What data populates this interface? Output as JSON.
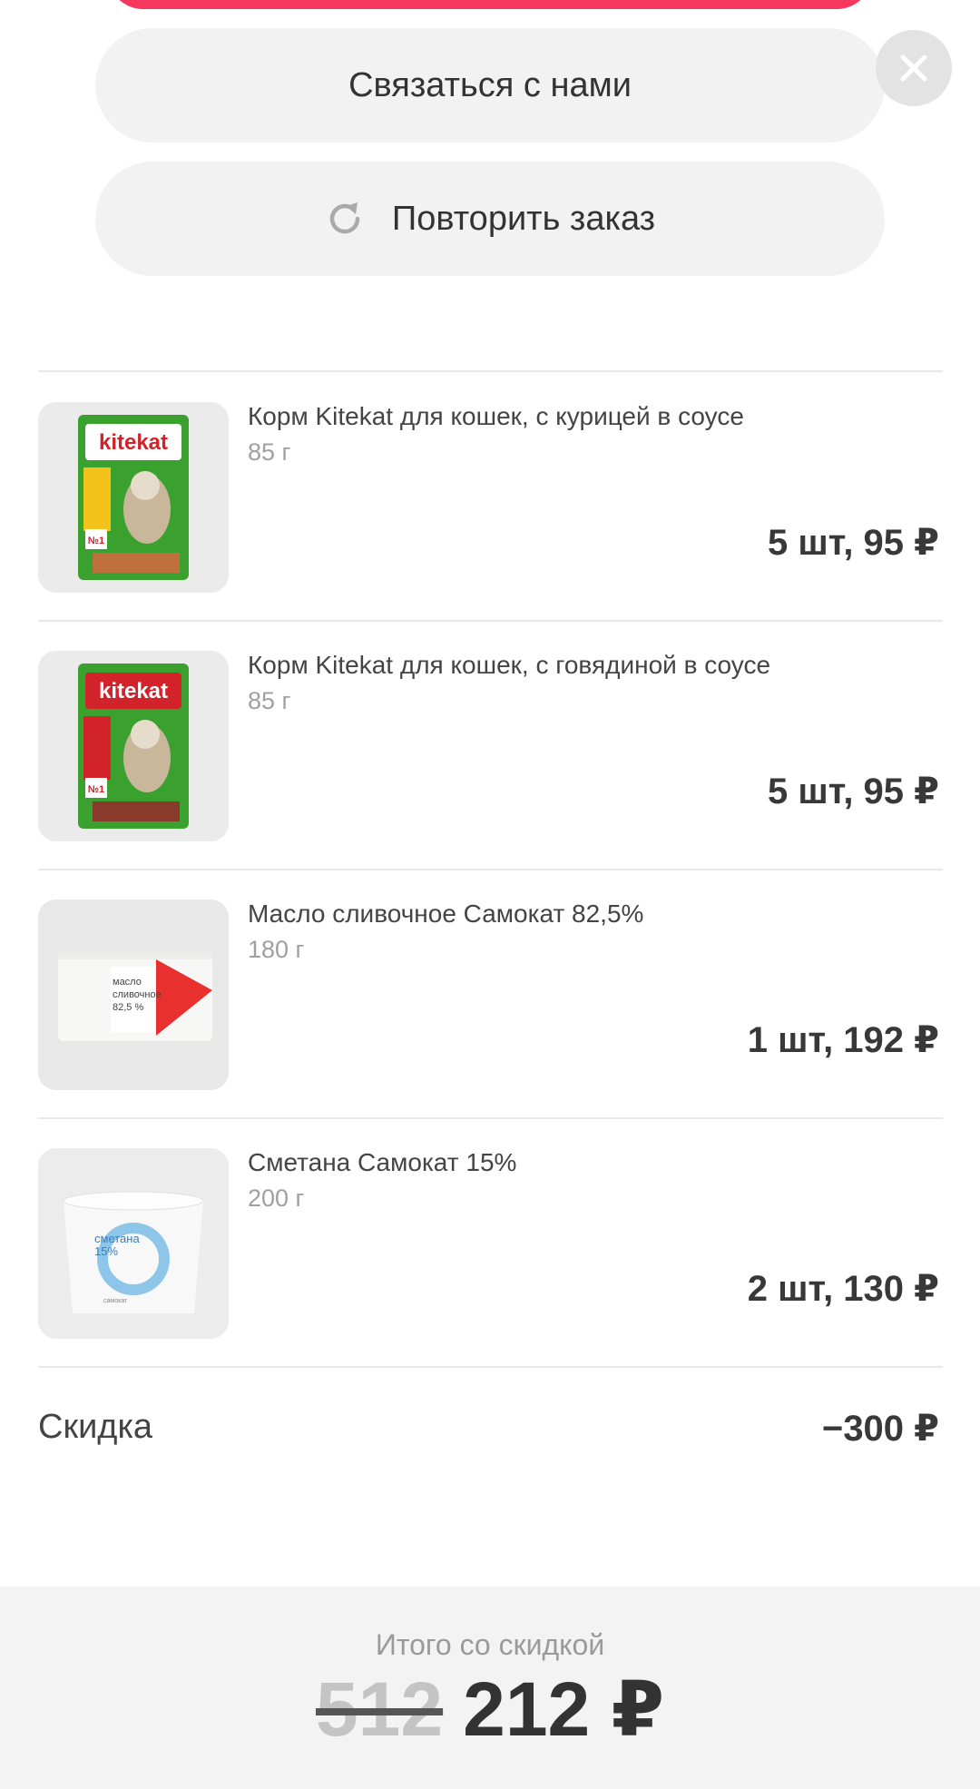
{
  "actions": {
    "contact_label": "Связаться с нами",
    "repeat_label": "Повторить заказ"
  },
  "items": [
    {
      "name": "Корм Kitekat для кошек, с курицей в соусе",
      "weight": "85 г",
      "price": "5 шт, 95 ₽",
      "image": {
        "brand": "kitekat",
        "badge": "№1"
      }
    },
    {
      "name": "Корм Kitekat для кошек, с говядиной в соусе",
      "weight": "85 г",
      "price": "5 шт, 95 ₽",
      "image": {
        "brand": "kitekat",
        "badge": "№1"
      }
    },
    {
      "name": "Масло сливочное Самокат 82,5%",
      "weight": "180 г",
      "price": "1 шт, 192 ₽",
      "image": {
        "label_line1": "масло",
        "label_line2": "сливочное",
        "label_line3": "82,5 %"
      }
    },
    {
      "name": "Сметана Самокат 15%",
      "weight": "200 г",
      "price": "2 шт, 130 ₽",
      "image": {
        "label_line1": "сметана",
        "label_line2": "15%",
        "brand": "самокат"
      }
    }
  ],
  "discount": {
    "label": "Скидка",
    "value": "−300 ₽"
  },
  "total": {
    "label": "Итого со скидкой",
    "old_value": "512",
    "new_value": "212 ₽"
  },
  "colors": {
    "accent": "#f5385d",
    "pill_bg": "#f2f2f2",
    "footer_bg": "#f3f3f3",
    "kitekat_green": "#3aa12f",
    "kitekat_red": "#d2232a"
  },
  "icons": {
    "close": "close-icon",
    "repeat": "refresh-icon"
  }
}
